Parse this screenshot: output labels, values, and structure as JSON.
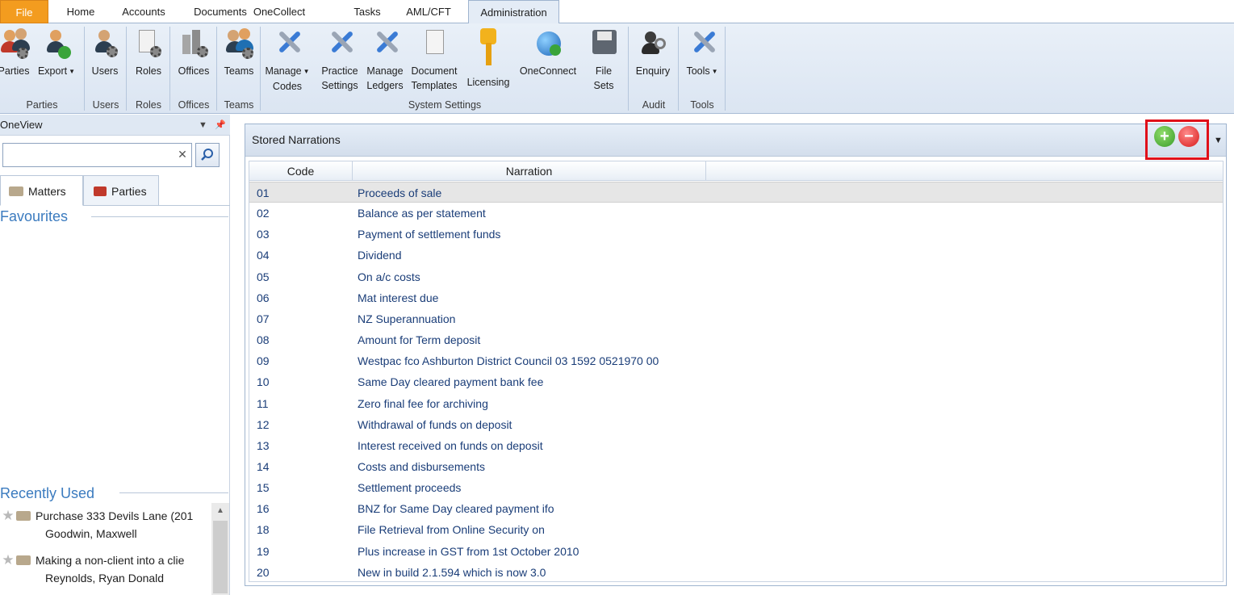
{
  "ribbon_tabs": [
    {
      "label": "File"
    },
    {
      "label": "Home"
    },
    {
      "label": "Accounts"
    },
    {
      "label": "Documents"
    },
    {
      "label": "OneCollect"
    },
    {
      "label": "Tasks"
    },
    {
      "label": "AML/CFT"
    },
    {
      "label": "Administration"
    }
  ],
  "ribbon": {
    "buttons": {
      "parties": "Parties",
      "export": "Export",
      "users": "Users",
      "roles": "Roles",
      "offices": "Offices",
      "teams": "Teams",
      "manage_codes_1": "Manage",
      "manage_codes_2": "Codes",
      "practice_settings_1": "Practice",
      "practice_settings_2": "Settings",
      "manage_ledgers_1": "Manage",
      "manage_ledgers_2": "Ledgers",
      "document_templates_1": "Document",
      "document_templates_2": "Templates",
      "licensing": "Licensing",
      "oneconnect": "OneConnect",
      "file_sets_1": "File",
      "file_sets_2": "Sets",
      "enquiry": "Enquiry",
      "tools": "Tools"
    },
    "groups": {
      "parties": "Parties",
      "users": "Users",
      "roles": "Roles",
      "offices": "Offices",
      "teams": "Teams",
      "system_settings": "System Settings",
      "audit": "Audit",
      "tools": "Tools"
    }
  },
  "oneview": {
    "title": "OneView",
    "search_value": "",
    "tabs": {
      "matters": "Matters",
      "parties": "Parties"
    },
    "favourites_title": "Favourites",
    "recently_used_title": "Recently Used",
    "recent_items": [
      {
        "title": "Purchase 333 Devils Lane (201",
        "client": "Goodwin, Maxwell"
      },
      {
        "title": "Making a non-client into a clie",
        "client": "Reynolds, Ryan Donald"
      }
    ]
  },
  "stored_narrations": {
    "title": "Stored Narrations",
    "columns": {
      "code": "Code",
      "narration": "Narration"
    },
    "rows": [
      {
        "code": "01",
        "narration": "Proceeds of sale"
      },
      {
        "code": "02",
        "narration": "Balance as per statement"
      },
      {
        "code": "03",
        "narration": "Payment of settlement funds"
      },
      {
        "code": "04",
        "narration": "Dividend"
      },
      {
        "code": "05",
        "narration": "On a/c costs"
      },
      {
        "code": "06",
        "narration": "Mat interest due"
      },
      {
        "code": "07",
        "narration": "NZ Superannuation"
      },
      {
        "code": "08",
        "narration": "Amount for Term deposit"
      },
      {
        "code": "09",
        "narration": "Westpac fco Ashburton District Council 03 1592 0521970 00"
      },
      {
        "code": "10",
        "narration": "Same Day cleared payment bank fee"
      },
      {
        "code": "11",
        "narration": "Zero final fee for archiving"
      },
      {
        "code": "12",
        "narration": "Withdrawal of funds on deposit"
      },
      {
        "code": "13",
        "narration": "Interest received on funds on deposit"
      },
      {
        "code": "14",
        "narration": "Costs and disbursements"
      },
      {
        "code": "15",
        "narration": "Settlement proceeds"
      },
      {
        "code": "16",
        "narration": "BNZ for Same Day cleared payment ifo"
      },
      {
        "code": "18",
        "narration": "File Retrieval from Online Security on"
      },
      {
        "code": "19",
        "narration": "Plus increase in GST from 1st October 2010"
      },
      {
        "code": "20",
        "narration": "New in build 2.1.594 which is now 3.0"
      }
    ]
  },
  "colors": {
    "file_tab": "#f39c1f",
    "link_text": "#1a3d78",
    "section_title": "#3b7bbf",
    "highlight_box": "#e0101a",
    "add_button": "#3a9c2a",
    "remove_button": "#d81a1a"
  },
  "icons": {
    "add": "plus-circle-icon",
    "remove": "minus-circle-icon",
    "search": "magnifier-icon",
    "clear": "close-icon",
    "pin": "pin-icon",
    "dropdown": "caret-down-icon"
  }
}
